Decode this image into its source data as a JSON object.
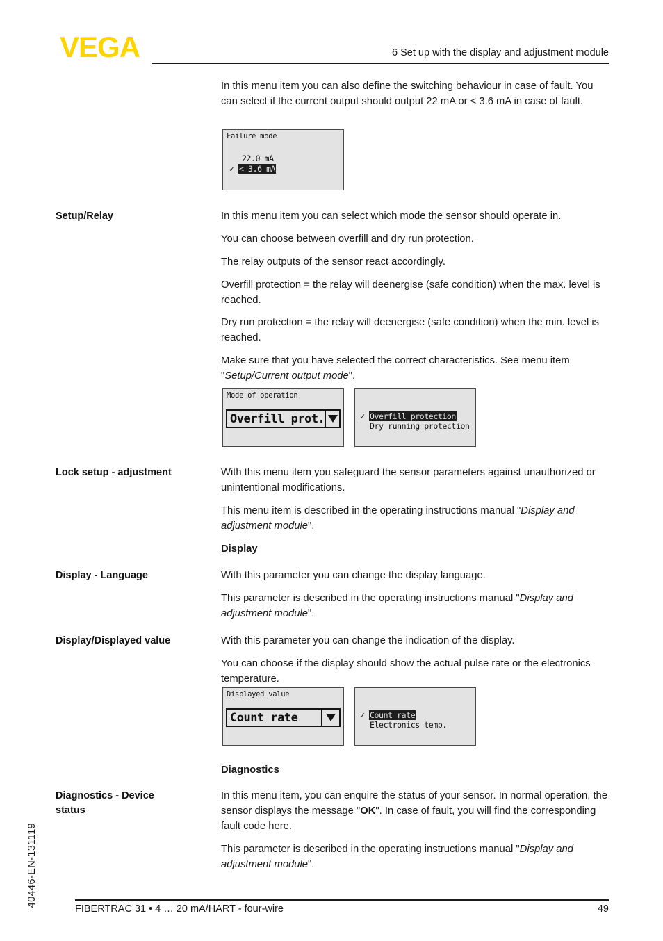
{
  "header": {
    "logo_text": "VEGA",
    "logo_color": "#fdd400",
    "chapter_title": "6 Set up with the display and adjustment module"
  },
  "intro": {
    "paragraph": "In this menu item you can also define the switching behaviour in case of fault. You can select if the current output should output 22 mA or < 3.6 mA in case of fault."
  },
  "lcd_failure_mode": {
    "title": "Failure mode",
    "option_1": "22.0 mA",
    "option_2": "< 3.6 mA",
    "checkmark": "✓",
    "selected_index": 1
  },
  "sections": [
    {
      "label": "Setup/Relay",
      "paragraphs": [
        "In this menu item you can select which mode the sensor should operate in.",
        "You can choose between overfill and dry run protection.",
        "The relay outputs of the sensor react accordingly.",
        "Overfill protection = the relay will deenergise (safe condition) when the max. level is reached.",
        "Dry run protection = the relay will deenergise (safe condition) when the min. level is reached."
      ],
      "note_prefix": "Make sure that you have selected the correct characteristics. See menu item \"",
      "note_italic": "Setup/Current output mode",
      "note_suffix": "\"."
    },
    {
      "label": "Lock setup - adjustment",
      "paragraphs": [
        "With this menu item you safeguard the sensor parameters against unauthorized or unintentional modifications."
      ],
      "note_prefix": "This menu item is described in the operating instructions manual \"",
      "note_italic": "Display and adjustment module",
      "note_suffix": "\"."
    },
    {
      "label": "Display - Language",
      "paragraphs": [
        "With this parameter you can change the display language."
      ],
      "note_prefix": "This parameter is described in the operating instructions manual \"",
      "note_italic": "Display and adjustment module",
      "note_suffix": "\"."
    },
    {
      "label": "Display/Displayed value",
      "paragraphs": [
        "With this parameter you can change the indication of the display.",
        "You can choose if the display should show the actual pulse rate or the electronics temperature."
      ]
    }
  ],
  "headings": {
    "display": "Display",
    "diagnostics": "Diagnostics"
  },
  "lcd_mode_of_operation": {
    "title": "Mode of operation",
    "field_value": "Overfill prot.",
    "arrow": "dropdown-arrow"
  },
  "lcd_mode_list": {
    "option_1": "Overfill protection",
    "option_2": "Dry running protection",
    "checkmark": "✓",
    "selected_index": 0
  },
  "lcd_displayed_value": {
    "title": "Displayed value",
    "field_value": "Count rate",
    "arrow": "dropdown-arrow"
  },
  "lcd_displayed_list": {
    "option_1": "Count rate",
    "option_2": "Electronics temp.",
    "checkmark": "✓",
    "selected_index": 0
  },
  "diagnostics_section": {
    "label_line_1": "Diagnostics - Device",
    "label_line_2": "status",
    "p1_a": "In this menu item, you can enquire the status of your sensor. In normal operation, the sensor displays the message \"",
    "p1_bold": "OK",
    "p1_b": "\". In case of fault, you will find the corresponding fault code here.",
    "p2_prefix": "This parameter is described in the operating instructions manual \"",
    "p2_italic": "Display and adjustment module",
    "p2_suffix": "\"."
  },
  "sidebar": {
    "document_code": "40446-EN-131119"
  },
  "footer": {
    "product": "FIBERTRAC 31 • 4 … 20 mA/HART - four-wire",
    "page_number": "49"
  }
}
